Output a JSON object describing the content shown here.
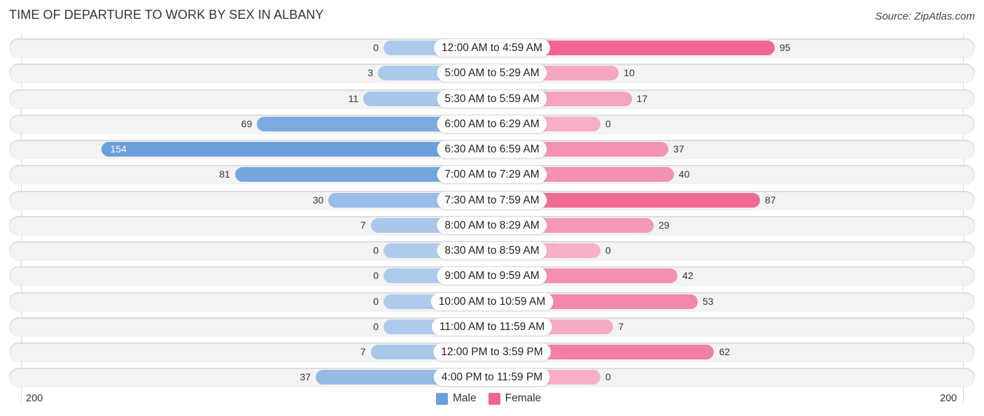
{
  "chart_data": {
    "type": "bar",
    "orientation": "horizontal-diverging",
    "title": "TIME OF DEPARTURE TO WORK BY SEX IN ALBANY",
    "source": "Source: ZipAtlas.com",
    "categories": [
      "12:00 AM to 4:59 AM",
      "5:00 AM to 5:29 AM",
      "5:30 AM to 5:59 AM",
      "6:00 AM to 6:29 AM",
      "6:30 AM to 6:59 AM",
      "7:00 AM to 7:29 AM",
      "7:30 AM to 7:59 AM",
      "8:00 AM to 8:29 AM",
      "8:30 AM to 8:59 AM",
      "9:00 AM to 9:59 AM",
      "10:00 AM to 10:59 AM",
      "11:00 AM to 11:59 AM",
      "12:00 PM to 3:59 PM",
      "4:00 PM to 11:59 PM"
    ],
    "series": [
      {
        "name": "Male",
        "color": "#6a9fdc",
        "values": [
          0,
          3,
          11,
          69,
          154,
          81,
          30,
          7,
          0,
          0,
          0,
          0,
          7,
          37
        ]
      },
      {
        "name": "Female",
        "color": "#f06590",
        "values": [
          95,
          10,
          17,
          0,
          37,
          40,
          87,
          29,
          0,
          42,
          53,
          7,
          62,
          0
        ]
      }
    ],
    "axis": {
      "left_tick": "200",
      "right_tick": "200",
      "range": [
        -200,
        200
      ]
    },
    "legend": {
      "position": "bottom-center",
      "items": [
        "Male",
        "Female"
      ]
    },
    "grid": false
  }
}
